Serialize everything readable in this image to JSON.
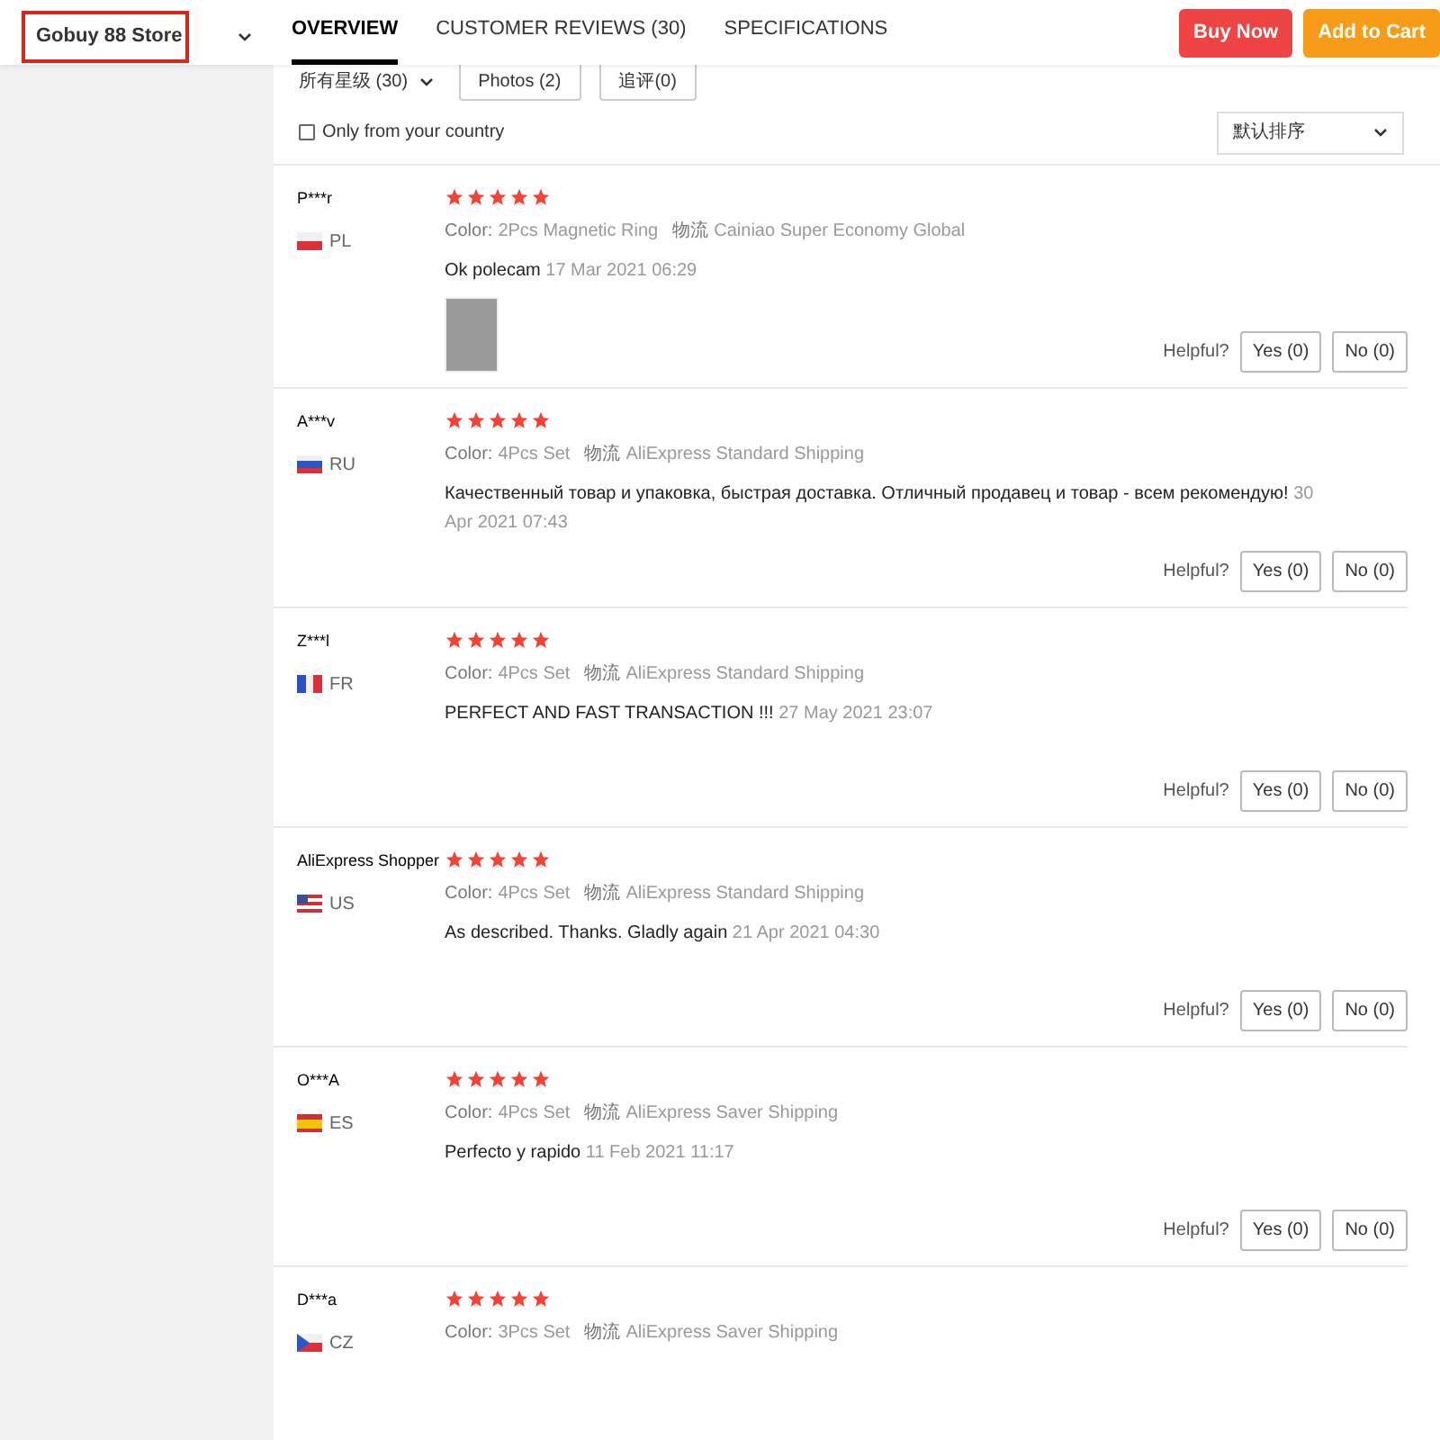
{
  "store_select": {
    "value": "Gobuy 88 Store"
  },
  "tabs": [
    {
      "label": "OVERVIEW",
      "selected": true
    },
    {
      "label": "CUSTOMER REVIEWS (30)",
      "selected": false
    },
    {
      "label": "SPECIFICATIONS",
      "selected": false
    }
  ],
  "actions": [
    {
      "label": "Buy Now",
      "kind": "buy"
    },
    {
      "label": "Add to Cart",
      "kind": "cart"
    }
  ],
  "filters": {
    "rating_select": "所有星级 (30)",
    "buttons": [
      "Photos (2)",
      "追评(0)"
    ],
    "country_checkbox": {
      "label": "Only from your country",
      "checked": false
    },
    "sort_select": "默认排序"
  },
  "reviews": [
    {
      "name": "P***r",
      "country": "PL",
      "stars": 5,
      "variant_label": "Color:",
      "variant": "2Pcs Magnetic Ring",
      "shipping_label": "物流",
      "shipping": "Cainiao Super Economy Global",
      "text": "Ok polecam",
      "date": "17 Mar 2021 06:29",
      "has_photo": true,
      "helpful": "Helpful?",
      "yes": "Yes (0)",
      "no": "No (0)"
    },
    {
      "name": "A***v",
      "country": "RU",
      "stars": 5,
      "variant_label": "Color:",
      "variant": "4Pcs Set",
      "shipping_label": "物流",
      "shipping": "AliExpress Standard Shipping",
      "text": "Качественный товар и упаковка, быстрая доставка. Отличный продавец и товар - всем рекомендую!",
      "date": "30 Apr 2021 07:43",
      "has_photo": false,
      "helpful": "Helpful?",
      "yes": "Yes (0)",
      "no": "No (0)"
    },
    {
      "name": "Z***l",
      "country": "FR",
      "stars": 5,
      "variant_label": "Color:",
      "variant": "4Pcs Set",
      "shipping_label": "物流",
      "shipping": "AliExpress Standard Shipping",
      "text": "PERFECT AND FAST TRANSACTION !!!",
      "date": "27 May 2021 23:07",
      "has_photo": false,
      "helpful": "Helpful?",
      "yes": "Yes (0)",
      "no": "No (0)"
    },
    {
      "name": "AliExpress Shopper",
      "country": "US",
      "stars": 5,
      "variant_label": "Color:",
      "variant": "4Pcs Set",
      "shipping_label": "物流",
      "shipping": "AliExpress Standard Shipping",
      "text": "As described. Thanks. Gladly again",
      "date": "21 Apr 2021 04:30",
      "has_photo": false,
      "helpful": "Helpful?",
      "yes": "Yes (0)",
      "no": "No (0)"
    },
    {
      "name": "O***A",
      "country": "ES",
      "stars": 5,
      "variant_label": "Color:",
      "variant": "4Pcs Set",
      "shipping_label": "物流",
      "shipping": "AliExpress Saver Shipping",
      "text": "Perfecto y rapido",
      "date": "11 Feb 2021 11:17",
      "has_photo": false,
      "helpful": "Helpful?",
      "yes": "Yes (0)",
      "no": "No (0)"
    },
    {
      "name": "D***a",
      "country": "CZ",
      "stars": 5,
      "variant_label": "Color:",
      "variant": "3Pcs Set",
      "shipping_label": "物流",
      "shipping": "AliExpress Saver Shipping"
    }
  ]
}
